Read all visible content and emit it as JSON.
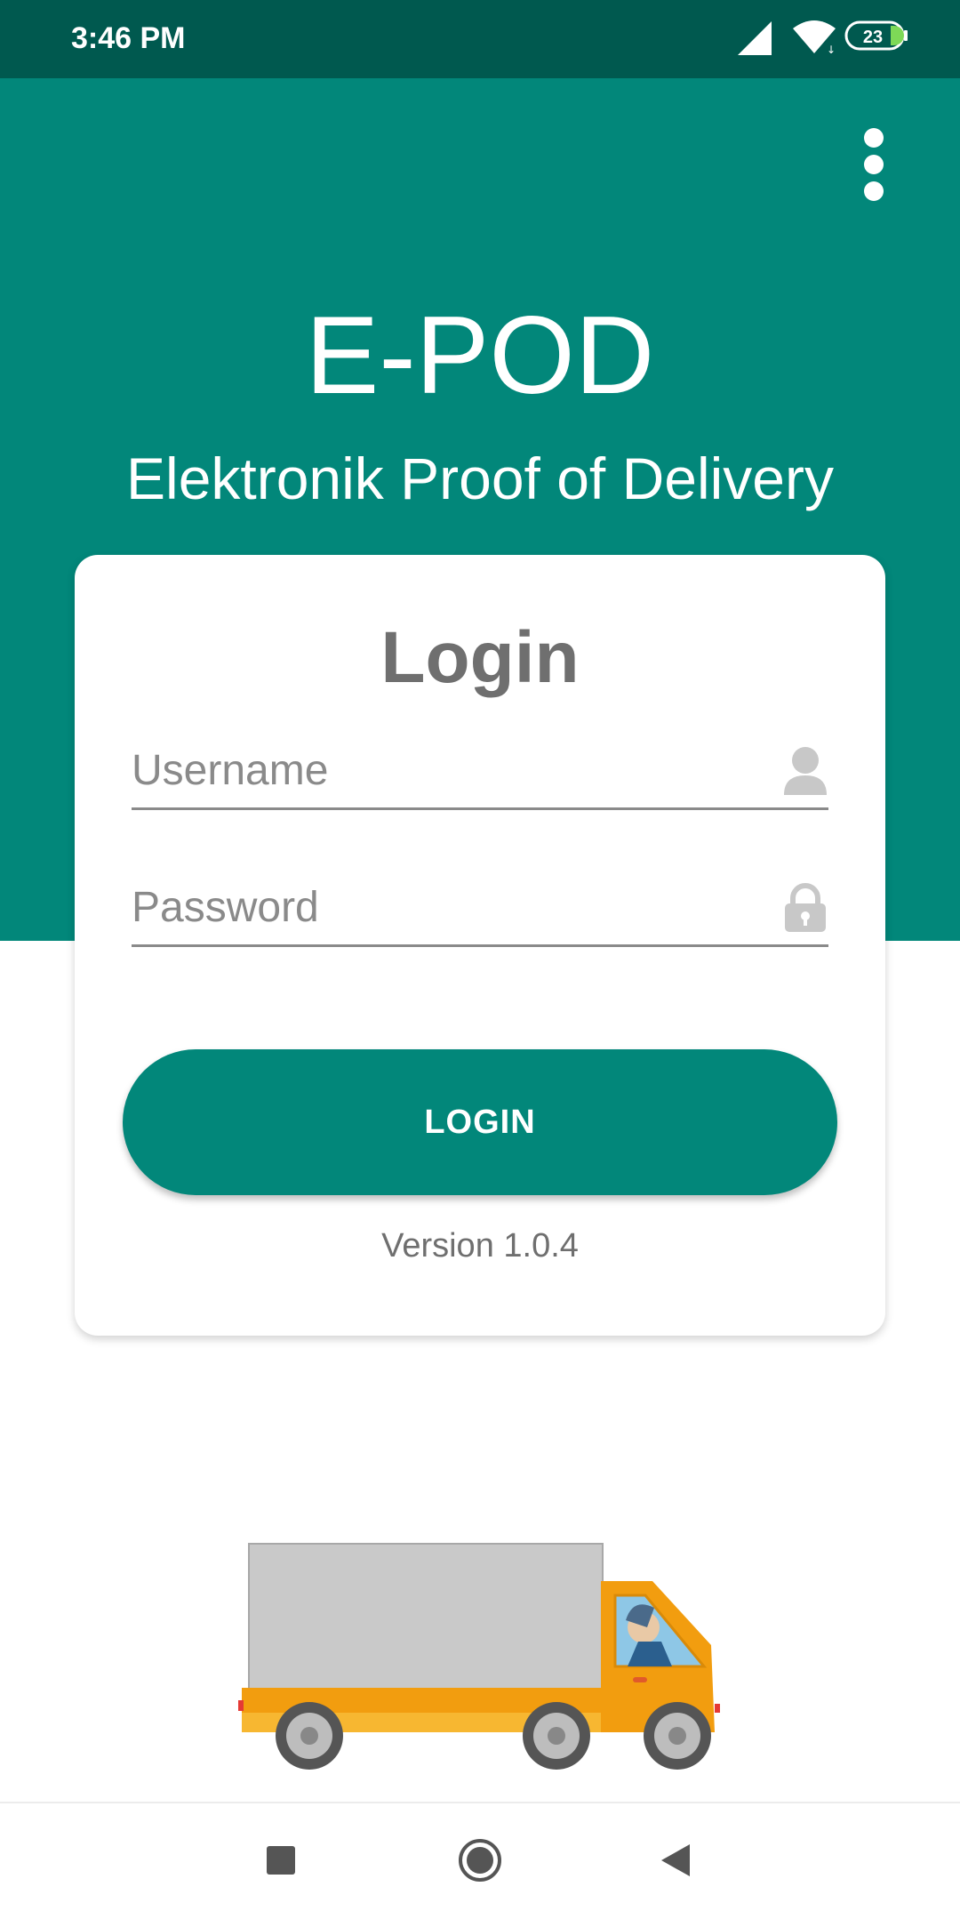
{
  "status_bar": {
    "time": "3:46 PM",
    "battery": "23"
  },
  "header": {
    "app_title": "E-POD",
    "app_subtitle": "Elektronik Proof of Delivery",
    "menu_icon": "more-vert-icon"
  },
  "login_card": {
    "title": "Login",
    "username_placeholder": "Username",
    "password_placeholder": "Password",
    "username_icon": "person-icon",
    "password_icon": "lock-icon",
    "login_button_label": "LOGIN",
    "version": "Version 1.0.4"
  },
  "illustration": {
    "icon": "delivery-truck-icon"
  },
  "nav_bar": {
    "icons": [
      "recents-square-icon",
      "home-circle-icon",
      "back-triangle-icon"
    ]
  },
  "colors": {
    "primary": "#02877a",
    "status_bar": "#00594f",
    "text_grey": "#6f6f6f"
  }
}
